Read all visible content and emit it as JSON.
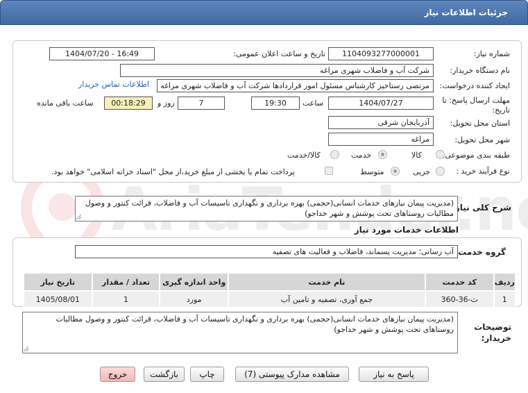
{
  "header": {
    "title": "جزئیات اطلاعات نیاز"
  },
  "form": {
    "need_number_label": "شماره نیاز:",
    "need_number": "1104093277000001",
    "announce_label": "تاریخ و ساعت اعلان عمومی:",
    "announce_value": "1404/07/20 - 16:49",
    "buyer_label": "نام دستگاه خریدار:",
    "buyer_value": "شرکت آب و فاضلاب شهری مراغه",
    "creator_label": "ایجاد کننده درخواست:",
    "creator_value": "مرتضی رستاخیز کارشناس مسئول امور قراردادها شرکت آب و فاضلاب شهری مراغه",
    "contact_link": "اطلاعات تماس خریدار",
    "deadline_label_1": "مهلت ارسال پاسخ: تا",
    "deadline_label_2": "تاریخ:",
    "deadline_date": "1404/07/27",
    "time_label": "ساعت",
    "deadline_time": "19:30",
    "days_value": "7",
    "days_label": "روز و",
    "remaining_time": "00:18:29",
    "remaining_label": "ساعت باقی مانده",
    "province_label": "استان محل تحویل:",
    "province_value": "آذربایجان شرقی",
    "city_label": "شهر محل تحویل:",
    "city_value": "مراغه",
    "category_label": "طبقه بندی موضوعی:",
    "category_options": [
      "کالا",
      "خدمت",
      "کالا/خدمت"
    ],
    "category_selected": "خدمت",
    "purchase_label": "نوع فرآیند خرید :",
    "purchase_options": [
      "جزیی",
      "متوسط"
    ],
    "purchase_selected": "متوسط",
    "payment_note": "پرداخت تمام یا بخشی از مبلغ خرید،از محل \"اسناد خزانه اسلامی\" خواهد بود."
  },
  "summary": {
    "label": "شرح کلی نیاز:",
    "text": "(مدیریت پیمان نیازهای خدمات انسانی(حجمی) بهره برداری و نگهداری تاسیسات آب و فاضلاب، قرائت کنتور و وصول مطالبات روستاهای تحت پوشش و شهر خداجو)"
  },
  "services": {
    "section_title": "اطلاعات خدمات مورد نیاز",
    "group_label": "گروه خدمت:",
    "group_value": "آب رسانی؛ مدیریت پسماند، فاضلاب و فعالیت های تصفیه",
    "columns": [
      "ردیف",
      "کد خدمت",
      "نام خدمت",
      "واحد اندازه گیری",
      "تعداد / مقدار",
      "تاریخ نیاز"
    ],
    "rows": [
      {
        "row": "1",
        "code": "ث-36-360",
        "name": "جمع آوری، تصفیه و تامین آب",
        "unit": "مورد",
        "qty": "1",
        "date": "1405/08/01"
      }
    ]
  },
  "buyer_notes": {
    "label_1": "توضیحات",
    "label_2": "خریدار:",
    "text": "(مدیریت پیمان نیازهای خدمات انسانی(حجمی) بهره برداری و نگهداری تاسیسات آب و فاضلاب، قرائت کنتور و وصول مطالبات روستاهای تحت پوشش و شهر خداجو)"
  },
  "buttons": {
    "reply": "پاسخ به نیاز",
    "attachments": "مشاهده مدارک پیوستی (7)",
    "print": "چاپ",
    "back": "بازگشت",
    "exit": "خروج"
  },
  "colors": {
    "header": "#4a74ad",
    "link": "#1d62b8",
    "remaining_bg": "#f7f0b8",
    "exit_bg": "#f2b8b8"
  },
  "watermark": {
    "text": "AriaTender.neT"
  }
}
